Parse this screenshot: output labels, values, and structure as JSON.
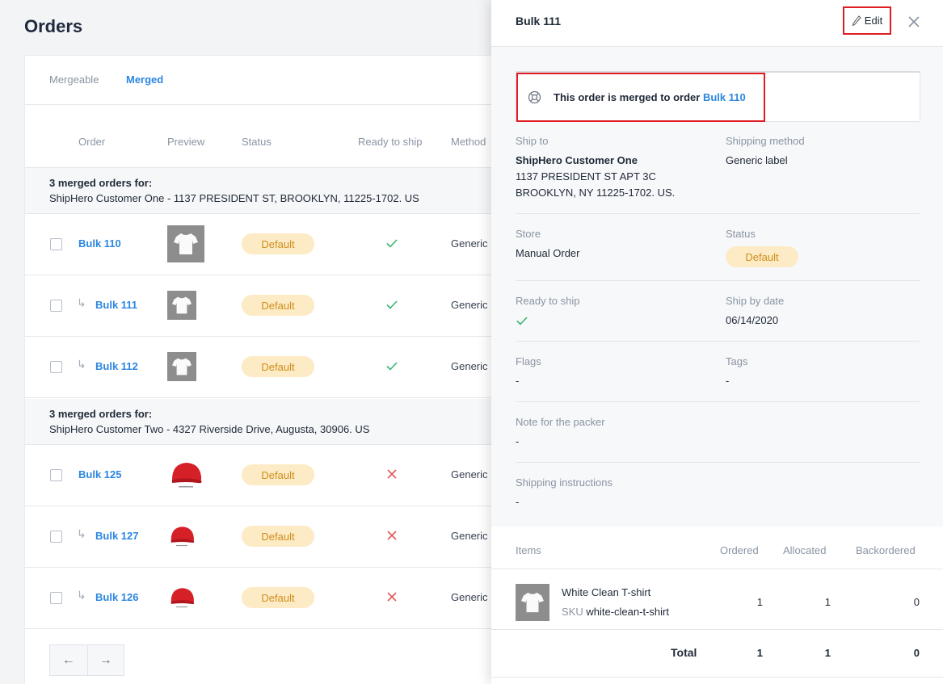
{
  "page": {
    "title": "Orders"
  },
  "tabs": [
    {
      "label": "Mergeable",
      "active": false
    },
    {
      "label": "Merged",
      "active": true
    }
  ],
  "columns": {
    "order": "Order",
    "preview": "Preview",
    "status": "Status",
    "ready": "Ready to ship",
    "method": "Method"
  },
  "groups": [
    {
      "title": "3 merged orders for:",
      "address": "ShipHero Customer One - 1137 PRESIDENT ST, BROOKLYN, 11225-1702. US",
      "rows": [
        {
          "order": "Bulk 110",
          "child": false,
          "preview": "white-tshirt-icon",
          "status": "Default",
          "ready": true,
          "method": "Generic"
        },
        {
          "order": "Bulk 111",
          "child": true,
          "preview": "white-tshirt-icon",
          "status": "Default",
          "ready": true,
          "method": "Generic"
        },
        {
          "order": "Bulk 112",
          "child": true,
          "preview": "white-tshirt-icon",
          "status": "Default",
          "ready": true,
          "method": "Generic"
        }
      ]
    },
    {
      "title": "3 merged orders for:",
      "address": "ShipHero Customer Two - 4327 Riverside Drive, Augusta, 30906. US",
      "rows": [
        {
          "order": "Bulk 125",
          "child": false,
          "preview": "red-cap-icon",
          "status": "Default",
          "ready": false,
          "method": "Generic"
        },
        {
          "order": "Bulk 127",
          "child": true,
          "preview": "red-cap-icon",
          "status": "Default",
          "ready": false,
          "method": "Generic"
        },
        {
          "order": "Bulk 126",
          "child": true,
          "preview": "red-cap-icon",
          "status": "Default",
          "ready": false,
          "method": "Generic"
        }
      ]
    }
  ],
  "pagination": {
    "prev_icon": "←",
    "next_icon": "→"
  },
  "drawer": {
    "title": "Bulk 111",
    "edit_label": "Edit",
    "merge_notice": {
      "text": "This order is merged to order ",
      "link": "Bulk 110"
    },
    "ship_to": {
      "label": "Ship to",
      "name": "ShipHero Customer One",
      "line1": "1137 PRESIDENT ST APT 3C",
      "line2": "BROOKLYN, NY 11225-1702. US."
    },
    "shipping_method": {
      "label": "Shipping method",
      "value": "Generic label"
    },
    "store": {
      "label": "Store",
      "value": "Manual Order"
    },
    "status": {
      "label": "Status",
      "value": "Default"
    },
    "ready_to_ship": {
      "label": "Ready to ship",
      "value": true
    },
    "ship_by_date": {
      "label": "Ship by date",
      "value": "06/14/2020"
    },
    "flags": {
      "label": "Flags",
      "value": "-"
    },
    "tags": {
      "label": "Tags",
      "value": "-"
    },
    "note": {
      "label": "Note for the packer",
      "value": "-"
    },
    "instructions": {
      "label": "Shipping instructions",
      "value": "-"
    },
    "items": {
      "headers": {
        "items": "Items",
        "ordered": "Ordered",
        "allocated": "Allocated",
        "backordered": "Backordered"
      },
      "rows": [
        {
          "name": "White Clean T-shirt",
          "sku_label": "SKU",
          "sku": "white-clean-t-shirt",
          "ordered": "1",
          "allocated": "1",
          "backordered": "0"
        }
      ],
      "total": {
        "label": "Total",
        "ordered": "1",
        "allocated": "1",
        "backordered": "0"
      }
    }
  },
  "colors": {
    "accent": "#2b86e0",
    "badge_bg": "#fcebc4",
    "badge_text": "#cf8e1f",
    "ok": "#3cb371",
    "error": "#e05a5a",
    "highlight": "#e01b22"
  }
}
